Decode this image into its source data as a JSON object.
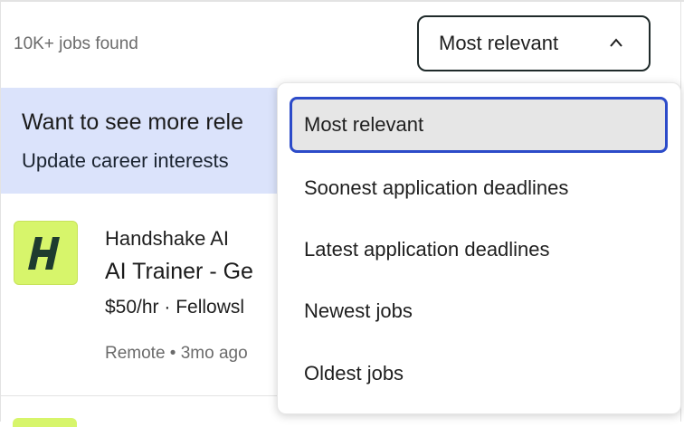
{
  "results": {
    "count_text": "10K+ jobs found"
  },
  "sort": {
    "selected_label": "Most relevant",
    "options": [
      "Most relevant",
      "Soonest application deadlines",
      "Latest application deadlines",
      "Newest jobs",
      "Oldest jobs"
    ]
  },
  "banner": {
    "title": "Want to see more rele",
    "link": "Update career interests"
  },
  "job": {
    "employer": "Handshake AI",
    "title": "AI Trainer - Ge",
    "pay": "$50/hr · Fellowsl",
    "meta": "Remote • 3mo ago",
    "logo_letter": "H",
    "logo_color": "#d7f56b"
  },
  "colors": {
    "accent": "#2c4bc9",
    "banner_bg": "#dbe3fb",
    "selected_bg": "#e6e6e6"
  }
}
